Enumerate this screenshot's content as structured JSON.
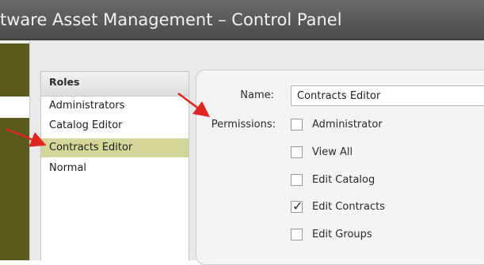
{
  "window": {
    "title": "tware Asset Management – Control Panel"
  },
  "roles": {
    "header": "Roles",
    "items": [
      {
        "label": "Administrators",
        "selected": false
      },
      {
        "label": "Catalog Editor",
        "selected": false
      },
      {
        "label": "Contracts Editor",
        "selected": true
      },
      {
        "label": "Normal",
        "selected": false
      }
    ]
  },
  "form": {
    "name_label": "Name:",
    "name_value": "Contracts Editor",
    "permissions_label": "Permissions:",
    "permissions": [
      {
        "label": "Administrator",
        "checked": false
      },
      {
        "label": "View All",
        "checked": false
      },
      {
        "label": "Edit Catalog",
        "checked": false
      },
      {
        "label": "Edit Contracts",
        "checked": true
      },
      {
        "label": "Edit Groups",
        "checked": false
      }
    ]
  },
  "colors": {
    "selection": "#d4d69a",
    "sidebar_strip": "#595a1d",
    "arrow": "#e0261e"
  }
}
